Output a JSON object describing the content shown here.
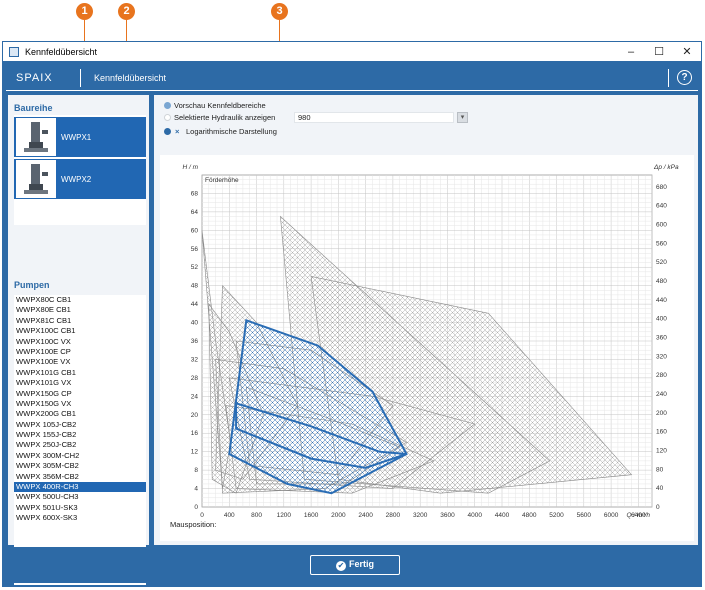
{
  "callouts": [
    "1",
    "2",
    "3"
  ],
  "window": {
    "title": "Kennfeldübersicht",
    "controls": {
      "minimize": "–",
      "maximize": "☐",
      "close": "✕"
    }
  },
  "header": {
    "logo": "SPAIX",
    "title": "Kennfeldübersicht",
    "help_icon": "?"
  },
  "baureihe": {
    "title": "Baureihe",
    "items": [
      {
        "label": "WWPX1",
        "selected": true
      },
      {
        "label": "WWPX2",
        "selected": true
      }
    ]
  },
  "pumpen": {
    "title": "Pumpen",
    "selected_index": 18,
    "items": [
      "WWPX80C CB1",
      "WWPX80E CB1",
      "WWPX81C CB1",
      "WWPX100C CB1",
      "WWPX100C VX",
      "WWPX100E CP",
      "WWPX100E VX",
      "WWPX101G CB1",
      "WWPX101G VX",
      "WWPX150G CP",
      "WWPX150G VX",
      "WWPX200G CB1",
      "WWPX 105J-CB2",
      "WWPX 155J-CB2",
      "WWPX 250J-CB2",
      "WWPX 300M-CH2",
      "WWPX 305M-CB2",
      "WWPX 356M-CB2",
      "WWPX 400R-CH3",
      "WWPX 500U-CH3",
      "WWPX 501U-SK3",
      "WWPX 600X-SK3"
    ]
  },
  "options": {
    "preview_label": "Vorschau Kennfeldbereiche",
    "selected_hydraulic_label": "Selektierte Hydraulik anzeigen",
    "selected_hydraulic_value": "980",
    "log_icon": "×",
    "log_label": "Logarithmische Darstellung"
  },
  "chart_data": {
    "type": "area",
    "left_axis_label": "H / m",
    "left_axis_title": "Förderhöhe",
    "right_axis_label": "Δp / kPa",
    "xlabel": "Q / m³/h",
    "xlim": [
      0,
      6600
    ],
    "ylim": [
      0,
      72
    ],
    "y2lim": [
      0,
      705
    ],
    "x_ticks": [
      0,
      400,
      800,
      1200,
      1600,
      2000,
      2400,
      2800,
      3200,
      3600,
      4000,
      4400,
      4800,
      5200,
      5600,
      6000,
      6400
    ],
    "y_ticks": [
      0,
      4,
      8,
      12,
      16,
      20,
      24,
      28,
      32,
      36,
      40,
      44,
      48,
      52,
      56,
      60,
      64,
      68
    ],
    "y2_ticks": [
      0,
      40,
      80,
      120,
      160,
      200,
      240,
      280,
      320,
      360,
      400,
      440,
      480,
      520,
      560,
      600,
      640,
      680
    ],
    "grid": true,
    "colors": {
      "background_fields": "#8a8a8a",
      "highlight": "#2a6db5"
    },
    "series": [
      {
        "points": [
          [
            0,
            60
          ],
          [
            200,
            36
          ],
          [
            420,
            14
          ],
          [
            300,
            4
          ]
        ]
      },
      {
        "points": [
          [
            1150,
            63
          ],
          [
            5100,
            10
          ],
          [
            4200,
            3
          ],
          [
            1500,
            6
          ]
        ]
      },
      {
        "points": [
          [
            1600,
            50
          ],
          [
            4200,
            42
          ],
          [
            6300,
            7
          ],
          [
            3500,
            3
          ],
          [
            2000,
            6
          ]
        ]
      },
      {
        "points": [
          [
            400,
            28
          ],
          [
            2500,
            24
          ],
          [
            4000,
            18
          ],
          [
            2800,
            4
          ],
          [
            700,
            6
          ]
        ]
      },
      {
        "points": [
          [
            200,
            32
          ],
          [
            1200,
            30
          ],
          [
            3000,
            14
          ],
          [
            1800,
            4
          ],
          [
            300,
            3
          ]
        ]
      },
      {
        "points": [
          [
            300,
            48
          ],
          [
            800,
            40
          ],
          [
            1400,
            22
          ],
          [
            600,
            6
          ],
          [
            200,
            8
          ]
        ]
      },
      {
        "points": [
          [
            500,
            36
          ],
          [
            1600,
            34
          ],
          [
            2800,
            22
          ],
          [
            2000,
            7
          ],
          [
            700,
            9
          ]
        ]
      },
      {
        "points": [
          [
            350,
            22
          ],
          [
            2200,
            18
          ],
          [
            3400,
            10
          ],
          [
            2200,
            3
          ],
          [
            500,
            4
          ]
        ]
      },
      {
        "points": [
          [
            100,
            44
          ],
          [
            400,
            38
          ],
          [
            900,
            20
          ],
          [
            500,
            3
          ],
          [
            150,
            6
          ]
        ]
      },
      {
        "points": [
          [
            650,
            26
          ],
          [
            1900,
            19
          ],
          [
            2900,
            13
          ],
          [
            2100,
            5
          ],
          [
            800,
            5
          ]
        ]
      }
    ],
    "highlight": [
      {
        "points": [
          [
            650,
            40.5
          ],
          [
            1700,
            35
          ],
          [
            2500,
            25
          ],
          [
            3000,
            11.5
          ],
          [
            1900,
            3
          ],
          [
            1250,
            5
          ],
          [
            400,
            11.5
          ]
        ]
      },
      {
        "points": [
          [
            500,
            22.5
          ],
          [
            1600,
            17.5
          ],
          [
            2600,
            12
          ],
          [
            3000,
            11.5
          ],
          [
            2400,
            8.5
          ],
          [
            1600,
            10.5
          ],
          [
            500,
            17
          ]
        ]
      }
    ],
    "mouse_position_label": "Mausposition:"
  },
  "footer": {
    "button_label": "Fertig",
    "button_icon": "✔"
  }
}
